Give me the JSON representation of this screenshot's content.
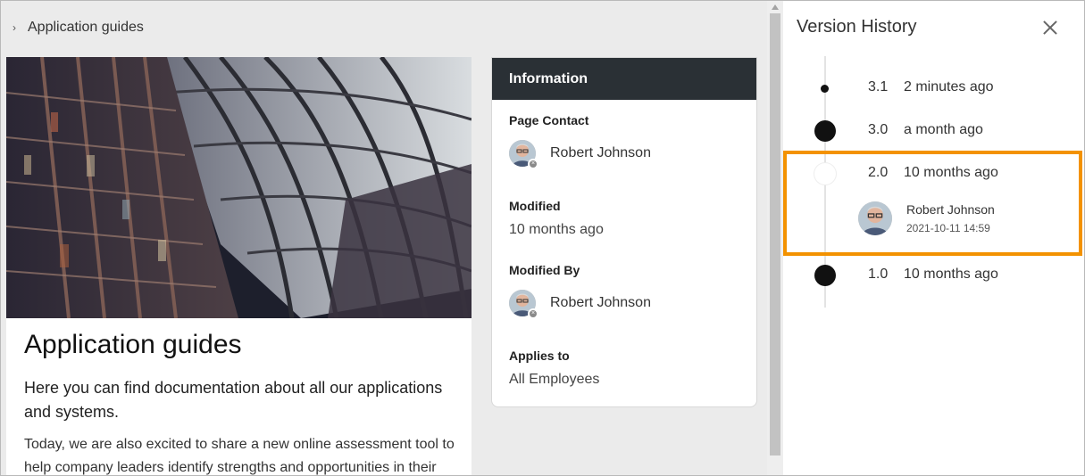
{
  "breadcrumb": {
    "label": "Application guides"
  },
  "article": {
    "title": "Application guides",
    "lead": "Here you can find documentation about all our applications and systems.",
    "body": "Today, we are also excited to share a new online assessment tool to help company leaders identify strengths and opportunities in their"
  },
  "info": {
    "header": "Information",
    "page_contact_label": "Page Contact",
    "page_contact_name": "Robert Johnson",
    "modified_label": "Modified",
    "modified_value": "10 months ago",
    "modified_by_label": "Modified By",
    "modified_by_name": "Robert Johnson",
    "applies_to_label": "Applies to",
    "applies_to_value": "All Employees"
  },
  "version_history": {
    "title": "Version History",
    "versions": [
      {
        "number": "3.1",
        "when": "2 minutes ago"
      },
      {
        "number": "3.0",
        "when": "a month ago"
      },
      {
        "number": "2.0",
        "when": "10 months ago",
        "author": "Robert Johnson",
        "timestamp": "2021-10-11 14:59",
        "selected": true
      },
      {
        "number": "1.0",
        "when": "10 months ago"
      }
    ]
  },
  "icons": {
    "breadcrumb": "chevron-right-icon",
    "close": "close-icon",
    "avatar_status": "status-offline-icon"
  },
  "colors": {
    "info_header_bg": "#2a3035",
    "selection_outline": "#f39200",
    "page_bg": "#ebebeb"
  }
}
